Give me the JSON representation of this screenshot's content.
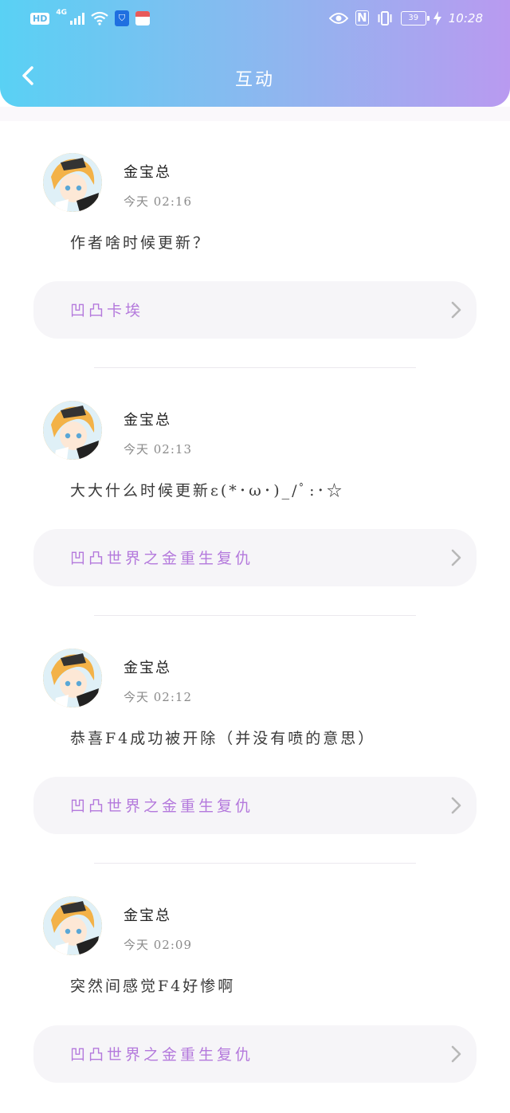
{
  "status_bar": {
    "hd_label": "HD",
    "network_label": "4G",
    "battery_level": "39",
    "time": "10:28",
    "nfc_label": "N"
  },
  "header": {
    "title": "互动"
  },
  "icons": {
    "back": "chevron-left-icon",
    "chevron": "chevron-right-icon",
    "wifi": "wifi-icon",
    "eye": "eye-icon",
    "vibrate": "vibrate-icon",
    "charging": "bolt-icon"
  },
  "colors": {
    "header_gradient_start": "#59d1f4",
    "header_gradient_end": "#b99af0",
    "link_text": "#b479dc",
    "link_background": "#f6f5f8"
  },
  "comments": [
    {
      "user": "金宝总",
      "time": "今天  02:16",
      "text": "作者啥时候更新？",
      "book": "凹凸卡埃"
    },
    {
      "user": "金宝总",
      "time": "今天  02:13",
      "text": "大大什么时候更新ε(*･ω･)_/ﾟ:･☆",
      "book": "凹凸世界之金重生复仇"
    },
    {
      "user": "金宝总",
      "time": "今天  02:12",
      "text": "恭喜F4成功被开除（并没有喷的意思）",
      "book": "凹凸世界之金重生复仇"
    },
    {
      "user": "金宝总",
      "time": "今天  02:09",
      "text": "突然间感觉F4好惨啊",
      "book": "凹凸世界之金重生复仇"
    }
  ]
}
